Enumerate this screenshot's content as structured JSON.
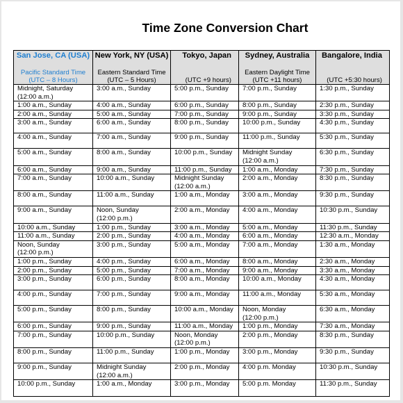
{
  "title": "Time Zone Conversion Chart",
  "accent_color": "#1f7fd0",
  "columns": [
    {
      "city": "San Jose, CA (USA)",
      "zone": "Pacific Standard Time",
      "utc": "(UTC – 8 Hours)"
    },
    {
      "city": "New York, NY (USA)",
      "zone": "Eastern Standard Time",
      "utc": "(UTC – 5 Hours)"
    },
    {
      "city": "Tokyo, Japan",
      "zone": "",
      "utc": "(UTC +9 hours)"
    },
    {
      "city": "Sydney, Australia",
      "zone": "Eastern Daylight Time",
      "utc": "(UTC +11 hours)"
    },
    {
      "city": "Bangalore, India",
      "zone": "",
      "utc": "(UTC +5:30 hours)"
    }
  ],
  "rows": [
    {
      "cells": [
        [
          "Midnight, Saturday",
          "(12:00 a.m.)"
        ],
        [
          "3:00 a.m., Sunday"
        ],
        [
          "5:00 p.m., Sunday"
        ],
        [
          "7:00 p.m., Sunday"
        ],
        [
          "1:30 p.m., Sunday"
        ]
      ]
    },
    {
      "cells": [
        [
          "1:00 a.m., Sunday"
        ],
        [
          "4:00 a.m., Sunday"
        ],
        [
          "6:00 p.m., Sunday"
        ],
        [
          "8:00 p.m., Sunday"
        ],
        [
          "2:30 p.m., Sunday"
        ]
      ]
    },
    {
      "cells": [
        [
          "2:00 a.m., Sunday"
        ],
        [
          "5:00 a.m., Sunday"
        ],
        [
          "7:00 p.m., Sunday"
        ],
        [
          "9:00 p.m., Sunday"
        ],
        [
          "3:30 p.m., Sunday"
        ]
      ]
    },
    {
      "cells": [
        [
          "3:00 a.m., Sunday"
        ],
        [
          "6:00 a.m., Sunday"
        ],
        [
          "8:00 p.m., Sunday"
        ],
        [
          "10:00 p.m., Sunday"
        ],
        [
          "4:30 p.m., Sunday"
        ]
      ]
    },
    {
      "cells": [
        [
          "4:00 a.m., Sunday"
        ],
        [
          "7:00 a.m., Sunday"
        ],
        [
          "9:00 p.m., Sunday"
        ],
        [
          "11:00 p.m., Sunday"
        ],
        [
          "5:30 p.m., Sunday"
        ]
      ]
    },
    {
      "cells": [
        [
          "5:00 a.m., Sunday"
        ],
        [
          "8:00 a.m., Sunday"
        ],
        [
          "10:00 p.m., Sunday"
        ],
        [
          "Midnight Sunday",
          "(12:00 a.m.)"
        ],
        [
          "6:30 p.m., Sunday"
        ]
      ]
    },
    {
      "cells": [
        [
          "6:00 a.m., Sunday"
        ],
        [
          "9:00 a.m., Sunday"
        ],
        [
          "11:00 p.m., Sunday"
        ],
        [
          "1:00 a.m., Monday"
        ],
        [
          "7:30 p.m., Sunday"
        ]
      ]
    },
    {
      "cells": [
        [
          "7:00 a.m., Sunday"
        ],
        [
          "10:00 a.m., Sunday"
        ],
        [
          "Midnight Sunday",
          "(12:00 a.m.)"
        ],
        [
          "2:00 a.m., Monday"
        ],
        [
          "8:30 p.m., Sunday"
        ]
      ]
    },
    {
      "cells": [
        [
          "8:00 a.m., Sunday"
        ],
        [
          "11:00 a.m., Sunday"
        ],
        [
          "1:00 a.m., Monday"
        ],
        [
          "3:00 a.m., Monday"
        ],
        [
          "9:30 p.m., Sunday"
        ]
      ]
    },
    {
      "cells": [
        [
          "9:00 a.m., Sunday"
        ],
        [
          "Noon, Sunday",
          "(12:00 p.m.)"
        ],
        [
          "2:00 a.m., Monday"
        ],
        [
          "4:00 a.m., Monday"
        ],
        [
          "10:30 p.m., Sunday"
        ]
      ]
    },
    {
      "cells": [
        [
          "10:00 a.m., Sunday"
        ],
        [
          "1:00 p.m., Sunday"
        ],
        [
          "3:00 a.m., Monday"
        ],
        [
          "5:00 a.m., Monday"
        ],
        [
          "11:30 p.m., Sunday"
        ]
      ]
    },
    {
      "cells": [
        [
          "11:00 a.m., Sunday"
        ],
        [
          "2:00 p.m., Sunday"
        ],
        [
          "4:00 a.m., Monday"
        ],
        [
          "6:00 a.m., Monday"
        ],
        [
          "12:30 a.m., Monday"
        ]
      ]
    },
    {
      "cells": [
        [
          "Noon, Sunday",
          "(12:00 p.m.)"
        ],
        [
          "3:00 p.m., Sunday"
        ],
        [
          "5:00 a.m., Monday"
        ],
        [
          "7:00 a.m., Monday"
        ],
        [
          "1:30 a.m., Monday"
        ]
      ]
    },
    {
      "cells": [
        [
          "1:00 p.m., Sunday"
        ],
        [
          "4:00 p.m., Sunday"
        ],
        [
          "6:00 a.m., Monday"
        ],
        [
          "8:00 a.m., Monday"
        ],
        [
          "2:30 a.m., Monday"
        ]
      ]
    },
    {
      "cells": [
        [
          "2:00 p.m., Sunday"
        ],
        [
          "5:00 p.m., Sunday"
        ],
        [
          "7:00 a.m., Monday"
        ],
        [
          "9:00 a.m., Monday"
        ],
        [
          "3:30 a.m., Monday"
        ]
      ]
    },
    {
      "cells": [
        [
          "3:00 p.m., Sunday"
        ],
        [
          "6:00 p.m., Sunday"
        ],
        [
          "8:00 a.m., Monday"
        ],
        [
          "10:00 a.m., Monday"
        ],
        [
          "4:30 a.m., Monday"
        ]
      ]
    },
    {
      "cells": [
        [
          "4:00 p.m., Sunday"
        ],
        [
          "7:00 p.m., Sunday"
        ],
        [
          "9:00 a.m., Monday"
        ],
        [
          "11:00 a.m., Monday"
        ],
        [
          "5:30 a.m., Monday"
        ]
      ]
    },
    {
      "cells": [
        [
          "5:00 p.m., Sunday"
        ],
        [
          "8:00 p.m., Sunday"
        ],
        [
          "10:00 a.m., Monday"
        ],
        [
          "Noon, Monday",
          "(12:00 p.m.)"
        ],
        [
          "6:30 a.m., Monday"
        ]
      ]
    },
    {
      "cells": [
        [
          "6:00 p.m., Sunday"
        ],
        [
          "9:00 p.m., Sunday"
        ],
        [
          "11:00 a.m., Monday"
        ],
        [
          "1:00 p.m., Monday"
        ],
        [
          "7:30 a.m., Monday"
        ]
      ]
    },
    {
      "cells": [
        [
          "7:00 p.m., Sunday"
        ],
        [
          "10:00 p.m., Sunday"
        ],
        [
          "Noon, Monday",
          "(12:00 p.m.)"
        ],
        [
          "2:00 p.m., Monday"
        ],
        [
          "8:30 p.m., Sunday"
        ]
      ]
    },
    {
      "cells": [
        [
          "8:00 p.m., Sunday"
        ],
        [
          "11:00 p.m., Sunday"
        ],
        [
          "1:00 p.m., Monday"
        ],
        [
          "3:00 p.m., Monday"
        ],
        [
          "9:30 p.m., Sunday"
        ]
      ]
    },
    {
      "cells": [
        [
          "9:00 p.m., Sunday"
        ],
        [
          "Midnight Sunday",
          "(12:00 a.m.)"
        ],
        [
          "2:00 p.m., Monday"
        ],
        [
          "4:00 p.m. Monday"
        ],
        [
          "10:30 p.m., Sunday"
        ]
      ]
    },
    {
      "cells": [
        [
          "10:00 p.m., Sunday"
        ],
        [
          "1:00 a.m., Monday"
        ],
        [
          "3:00 p.m., Monday"
        ],
        [
          "5:00 p.m. Monday"
        ],
        [
          "11:30 p.m., Sunday"
        ]
      ]
    }
  ]
}
